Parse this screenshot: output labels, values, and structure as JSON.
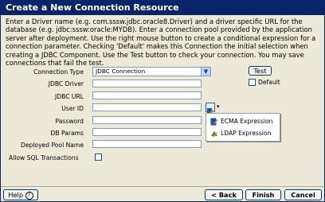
{
  "window": {
    "title": "Create a New Connection Resource"
  },
  "description": "Enter a Driver name (e.g. com.sssw.jdbc.oracle8.Driver) and a driver specific URL for the database (e.g. jdbc:sssw:oracle:MYDB). Enter a connection pool provided by the application server after deployment. Use the right mouse button to create a conditional expression for a connection parameter. Checking 'Default' makes this Connection the initial selection when creating a JDBC Component. Use the Test button to check your connection. You may save connections that fail the test.",
  "form": {
    "connection_type": {
      "label": "Connection Type",
      "value": "JDBC Connection"
    },
    "jdbc_driver": {
      "label": "JDBC Driver",
      "value": ""
    },
    "jdbc_url": {
      "label": "JDBC URL",
      "value": ""
    },
    "user_id": {
      "label": "User ID",
      "value": ""
    },
    "password": {
      "label": "Password",
      "value": ""
    },
    "db_params": {
      "label": "DB Params",
      "value": ""
    },
    "deployed_pool_name": {
      "label": "Deployed Pool Name",
      "value": ""
    },
    "allow_sql_transactions": {
      "label": "Allow SQL Transactions",
      "checked": false
    }
  },
  "test_button": {
    "label": "Test"
  },
  "default_checkbox": {
    "label": "Default",
    "checked": false
  },
  "expression_menu": {
    "items": [
      {
        "label": "ECMA Expression",
        "icon": "ecma-expression-icon"
      },
      {
        "label": "LDAP Expression",
        "icon": "ldap-expression-icon"
      }
    ]
  },
  "footer": {
    "help_label": "Help",
    "help_icon": "question-circle-icon",
    "back_label": "< Back",
    "finish_label": "Finish",
    "cancel_label": "Cancel"
  }
}
